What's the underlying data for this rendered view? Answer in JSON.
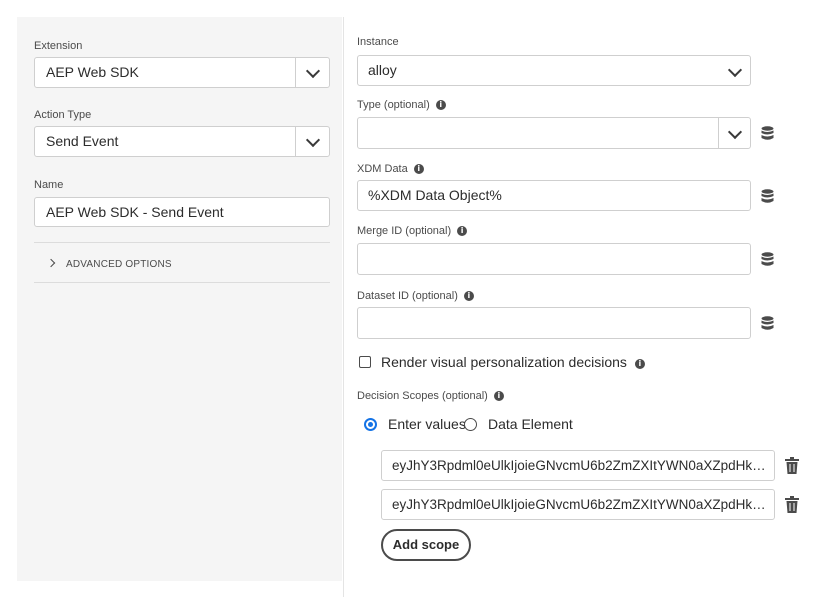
{
  "left": {
    "extension_label": "Extension",
    "extension_value": "AEP Web SDK",
    "action_type_label": "Action Type",
    "action_type_value": "Send Event",
    "name_label": "Name",
    "name_value": "AEP Web SDK - Send Event",
    "advanced_options_label": "ADVANCED OPTIONS"
  },
  "right": {
    "instance_label": "Instance",
    "instance_value": "alloy",
    "type_label": "Type (optional)",
    "type_value": "",
    "xdm_label": "XDM Data",
    "xdm_value": "%XDM Data Object%",
    "merge_id_label": "Merge ID (optional)",
    "merge_id_value": "",
    "dataset_id_label": "Dataset ID (optional)",
    "dataset_id_value": "",
    "render_label": "Render visual personalization decisions",
    "render_checked": false,
    "decision_scopes_label": "Decision Scopes (optional)",
    "radio_enter_values": "Enter values",
    "radio_data_element": "Data Element",
    "radio_selected": "Enter values",
    "scopes": [
      "eyJhY3Rpdml0eUlkIjoieGNvcmU6b2ZmZXItYWN0aXZpdHk6MT...",
      "eyJhY3Rpdml0eUlkIjoieGNvcmU6b2ZmZXItYWN0aXZpdHk6MT..."
    ],
    "add_scope_label": "Add scope"
  },
  "icons": {
    "info": "info-icon",
    "data_element": "database-icon",
    "trash": "trash-icon",
    "chevron": "chevron-down-icon"
  },
  "colors": {
    "accent": "#1473e6",
    "panel_bg": "#f5f5f5"
  }
}
